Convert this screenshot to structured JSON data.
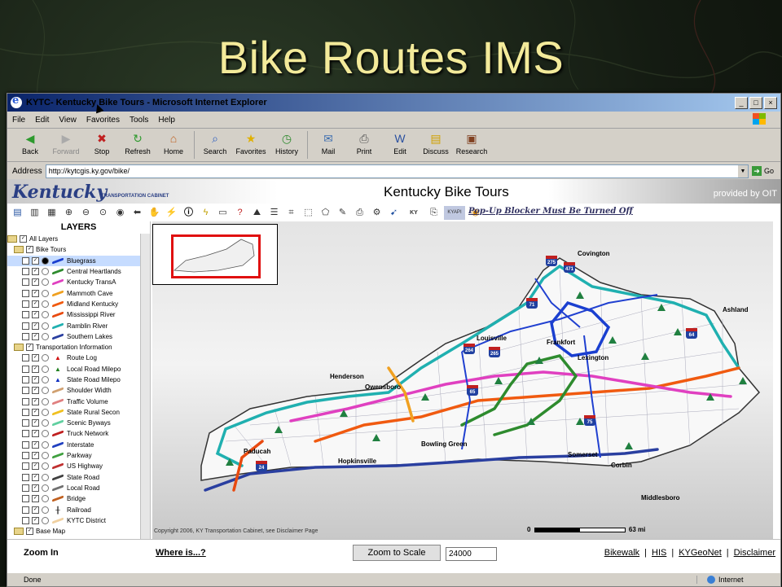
{
  "slide": {
    "title": "Bike Routes IMS"
  },
  "window": {
    "title": "KYTC- Kentucky Bike Tours - Microsoft Internet Explorer",
    "controls": [
      "_",
      "□",
      "×"
    ]
  },
  "menu": {
    "items": [
      "File",
      "Edit",
      "View",
      "Favorites",
      "Tools",
      "Help"
    ]
  },
  "toolbar": {
    "buttons": [
      {
        "label": "Back",
        "icon": "back-arrow-icon"
      },
      {
        "label": "Forward",
        "icon": "forward-arrow-icon"
      },
      {
        "label": "Stop",
        "icon": "stop-icon"
      },
      {
        "label": "Refresh",
        "icon": "refresh-icon"
      },
      {
        "label": "Home",
        "icon": "home-icon"
      },
      {
        "label": "Search",
        "icon": "search-icon"
      },
      {
        "label": "Favorites",
        "icon": "star-icon"
      },
      {
        "label": "History",
        "icon": "history-icon"
      },
      {
        "label": "Mail",
        "icon": "mail-icon"
      },
      {
        "label": "Print",
        "icon": "printer-icon"
      },
      {
        "label": "Edit",
        "icon": "edit-icon"
      },
      {
        "label": "Discuss",
        "icon": "discuss-icon"
      },
      {
        "label": "Research",
        "icon": "research-icon"
      }
    ]
  },
  "address": {
    "label": "Address",
    "url": "http://kytcgis.ky.gov/bike/",
    "go": "Go"
  },
  "banner": {
    "logo": "Kentucky",
    "logo_sub": "TRANSPORTATION CABINET",
    "title": "Kentucky Bike Tours",
    "provided_by": "provided by OIT"
  },
  "popup_notice": "Pop-Up Blocker Must Be Turned Off",
  "layers": {
    "heading": "LAYERS",
    "items": [
      {
        "label": "All Layers",
        "kind": "group"
      },
      {
        "label": "Bike Tours",
        "kind": "group"
      },
      {
        "label": "Bluegrass",
        "color": "#1a3fd0",
        "selected": true
      },
      {
        "label": "Central Heartlands",
        "color": "#2e8b2e"
      },
      {
        "label": "Kentucky TransA",
        "color": "#e040c0"
      },
      {
        "label": "Mammoth Cave",
        "color": "#f0a020"
      },
      {
        "label": "Midland Kentucky",
        "color": "#f05a10"
      },
      {
        "label": "Mississippi River",
        "color": "#e84a10"
      },
      {
        "label": "Ramblin River",
        "color": "#20b0b0"
      },
      {
        "label": "Southern Lakes",
        "color": "#2a3fa0"
      },
      {
        "label": "Transportation Information",
        "kind": "group"
      },
      {
        "label": "Route Log",
        "symbol": "▲",
        "color": "#d01010"
      },
      {
        "label": "Local Road Milepo",
        "symbol": "▲",
        "color": "#208020"
      },
      {
        "label": "State Road Milepo",
        "symbol": "▲",
        "color": "#1030c0"
      },
      {
        "label": "Shoulder Width",
        "color": "#d0a070"
      },
      {
        "label": "Traffic Volume",
        "color": "#e08080"
      },
      {
        "label": "State Rural Secon",
        "color": "#f0c020"
      },
      {
        "label": "Scenic Byways",
        "color": "#60d0a0"
      },
      {
        "label": "Truck Network",
        "color": "#c02020"
      },
      {
        "label": "Interstate",
        "color": "#2040c0"
      },
      {
        "label": "Parkway",
        "color": "#40a040"
      },
      {
        "label": "US Highway",
        "color": "#c03030"
      },
      {
        "label": "State Road",
        "color": "#404040"
      },
      {
        "label": "Local Road",
        "color": "#707070"
      },
      {
        "label": "Bridge",
        "color": "#c06020"
      },
      {
        "label": "Railroad",
        "symbol": "╫",
        "color": "#000000"
      },
      {
        "label": "KYTC District",
        "color": "#f0d0a0"
      },
      {
        "label": "Base Map",
        "kind": "group"
      }
    ]
  },
  "map": {
    "cities": [
      {
        "name": "Covington"
      },
      {
        "name": "Ashland"
      },
      {
        "name": "Louisville"
      },
      {
        "name": "Frankfort"
      },
      {
        "name": "Lexington"
      },
      {
        "name": "Henderson"
      },
      {
        "name": "Owensboro"
      },
      {
        "name": "Paducah"
      },
      {
        "name": "Bowling Green"
      },
      {
        "name": "Hopkinsville"
      },
      {
        "name": "Somerset"
      },
      {
        "name": "Corbin"
      },
      {
        "name": "Middlesboro"
      }
    ],
    "shields": [
      "275",
      "471",
      "71",
      "64",
      "264",
      "265",
      "65",
      "75",
      "24"
    ],
    "copyright": "Copyright 2006, KY Transportation Cabinet, see Disclaimer Page",
    "scale_start": "0",
    "scale_end": "63 mi"
  },
  "bottom": {
    "zoom_in": "Zoom In",
    "where_is": "Where is...?",
    "zoom_to_scale": "Zoom to Scale",
    "scale_value": "24000",
    "links": [
      "Bikewalk",
      "HIS",
      "KYGeoNet",
      "Disclaimer"
    ]
  },
  "status": {
    "text": "Done",
    "zone": "Internet"
  }
}
